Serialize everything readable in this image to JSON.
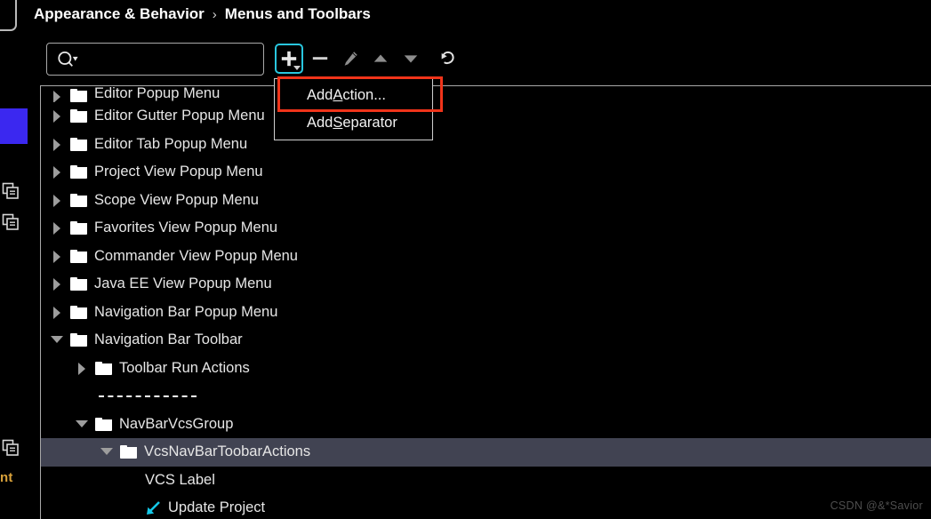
{
  "window": {
    "background_color": "#000000",
    "text_color": "#e6e6e6"
  },
  "breadcrumb": {
    "parent": "Appearance & Behavior",
    "separator": "›",
    "current": "Menus and Toolbars"
  },
  "search": {
    "value": "",
    "placeholder": "",
    "icon": "search-icon"
  },
  "toolbar": {
    "buttons": [
      {
        "name": "add-button",
        "icon": "plus-icon",
        "enabled": true,
        "focused": true,
        "has_dropdown": true
      },
      {
        "name": "remove-button",
        "icon": "minus-icon",
        "enabled": true,
        "focused": false,
        "has_dropdown": false
      },
      {
        "name": "edit-button",
        "icon": "pencil-icon",
        "enabled": false,
        "focused": false,
        "has_dropdown": false
      },
      {
        "name": "move-up-button",
        "icon": "arrow-up-icon",
        "enabled": false,
        "focused": false,
        "has_dropdown": false
      },
      {
        "name": "move-down-button",
        "icon": "arrow-down-icon",
        "enabled": false,
        "focused": false,
        "has_dropdown": false
      },
      {
        "name": "restore-defaults-button",
        "icon": "revert-icon",
        "enabled": true,
        "focused": false,
        "has_dropdown": false
      }
    ],
    "focus_ring_color": "#29c7df"
  },
  "add_menu": {
    "visible": true,
    "highlight_color": "#f0341a",
    "items": [
      {
        "label_before": "Add ",
        "mnemonic": "A",
        "label_after": "ction...",
        "full": "Add Action...",
        "highlighted": true
      },
      {
        "label_before": "Add ",
        "mnemonic": "S",
        "label_after": "eparator",
        "full": "Add Separator",
        "highlighted": false
      }
    ]
  },
  "tree": {
    "selected_row_color": "#414352",
    "rows": [
      {
        "label": "Editor Popup Menu",
        "indent": 0,
        "twisty": "right",
        "icon": "folder-icon",
        "selected": false,
        "clipped": true
      },
      {
        "label": "Editor Gutter Popup Menu",
        "indent": 0,
        "twisty": "right",
        "icon": "folder-icon",
        "selected": false,
        "clipped": false
      },
      {
        "label": "Editor Tab Popup Menu",
        "indent": 0,
        "twisty": "right",
        "icon": "folder-icon",
        "selected": false,
        "clipped": false
      },
      {
        "label": "Project View Popup Menu",
        "indent": 0,
        "twisty": "right",
        "icon": "folder-icon",
        "selected": false,
        "clipped": false
      },
      {
        "label": "Scope View Popup Menu",
        "indent": 0,
        "twisty": "right",
        "icon": "folder-icon",
        "selected": false,
        "clipped": false
      },
      {
        "label": "Favorites View Popup Menu",
        "indent": 0,
        "twisty": "right",
        "icon": "folder-icon",
        "selected": false,
        "clipped": false
      },
      {
        "label": "Commander View Popup Menu",
        "indent": 0,
        "twisty": "right",
        "icon": "folder-icon",
        "selected": false,
        "clipped": false
      },
      {
        "label": "Java EE View Popup Menu",
        "indent": 0,
        "twisty": "right",
        "icon": "folder-icon",
        "selected": false,
        "clipped": false
      },
      {
        "label": "Navigation Bar Popup Menu",
        "indent": 0,
        "twisty": "right",
        "icon": "folder-icon",
        "selected": false,
        "clipped": false
      },
      {
        "label": "Navigation Bar Toolbar",
        "indent": 0,
        "twisty": "down",
        "icon": "folder-icon",
        "selected": false,
        "clipped": false
      },
      {
        "label": "Toolbar Run Actions",
        "indent": 1,
        "twisty": "right",
        "icon": "folder-icon",
        "selected": false,
        "clipped": false
      },
      {
        "label": "",
        "indent": 1,
        "twisty": "none",
        "icon": "separator",
        "selected": false,
        "clipped": false
      },
      {
        "label": "NavBarVcsGroup",
        "indent": 1,
        "twisty": "down",
        "icon": "folder-icon",
        "selected": false,
        "clipped": false
      },
      {
        "label": "VcsNavBarToobarActions",
        "indent": 2,
        "twisty": "down",
        "icon": "folder-icon",
        "selected": true,
        "clipped": false
      },
      {
        "label": "VCS Label",
        "indent": 3,
        "twisty": "none",
        "icon": "none",
        "selected": false,
        "clipped": false
      },
      {
        "label": "Update Project",
        "indent": 3,
        "twisty": "none",
        "icon": "update-arrow-icon",
        "selected": false,
        "clipped": false
      }
    ]
  },
  "left_rail": {
    "accent_color": "#3b28f0",
    "truncated_label": "nt",
    "items": [
      {
        "name": "rail-outline-box",
        "icon": "rounded-square-icon"
      },
      {
        "name": "rail-accent-block",
        "icon": "blue-block"
      },
      {
        "name": "rail-copy-icon-1",
        "icon": "copy-icon"
      },
      {
        "name": "rail-copy-icon-2",
        "icon": "copy-icon"
      },
      {
        "name": "rail-copy-icon-3",
        "icon": "copy-icon"
      }
    ]
  },
  "watermark": {
    "text": "CSDN @&*Savior"
  }
}
